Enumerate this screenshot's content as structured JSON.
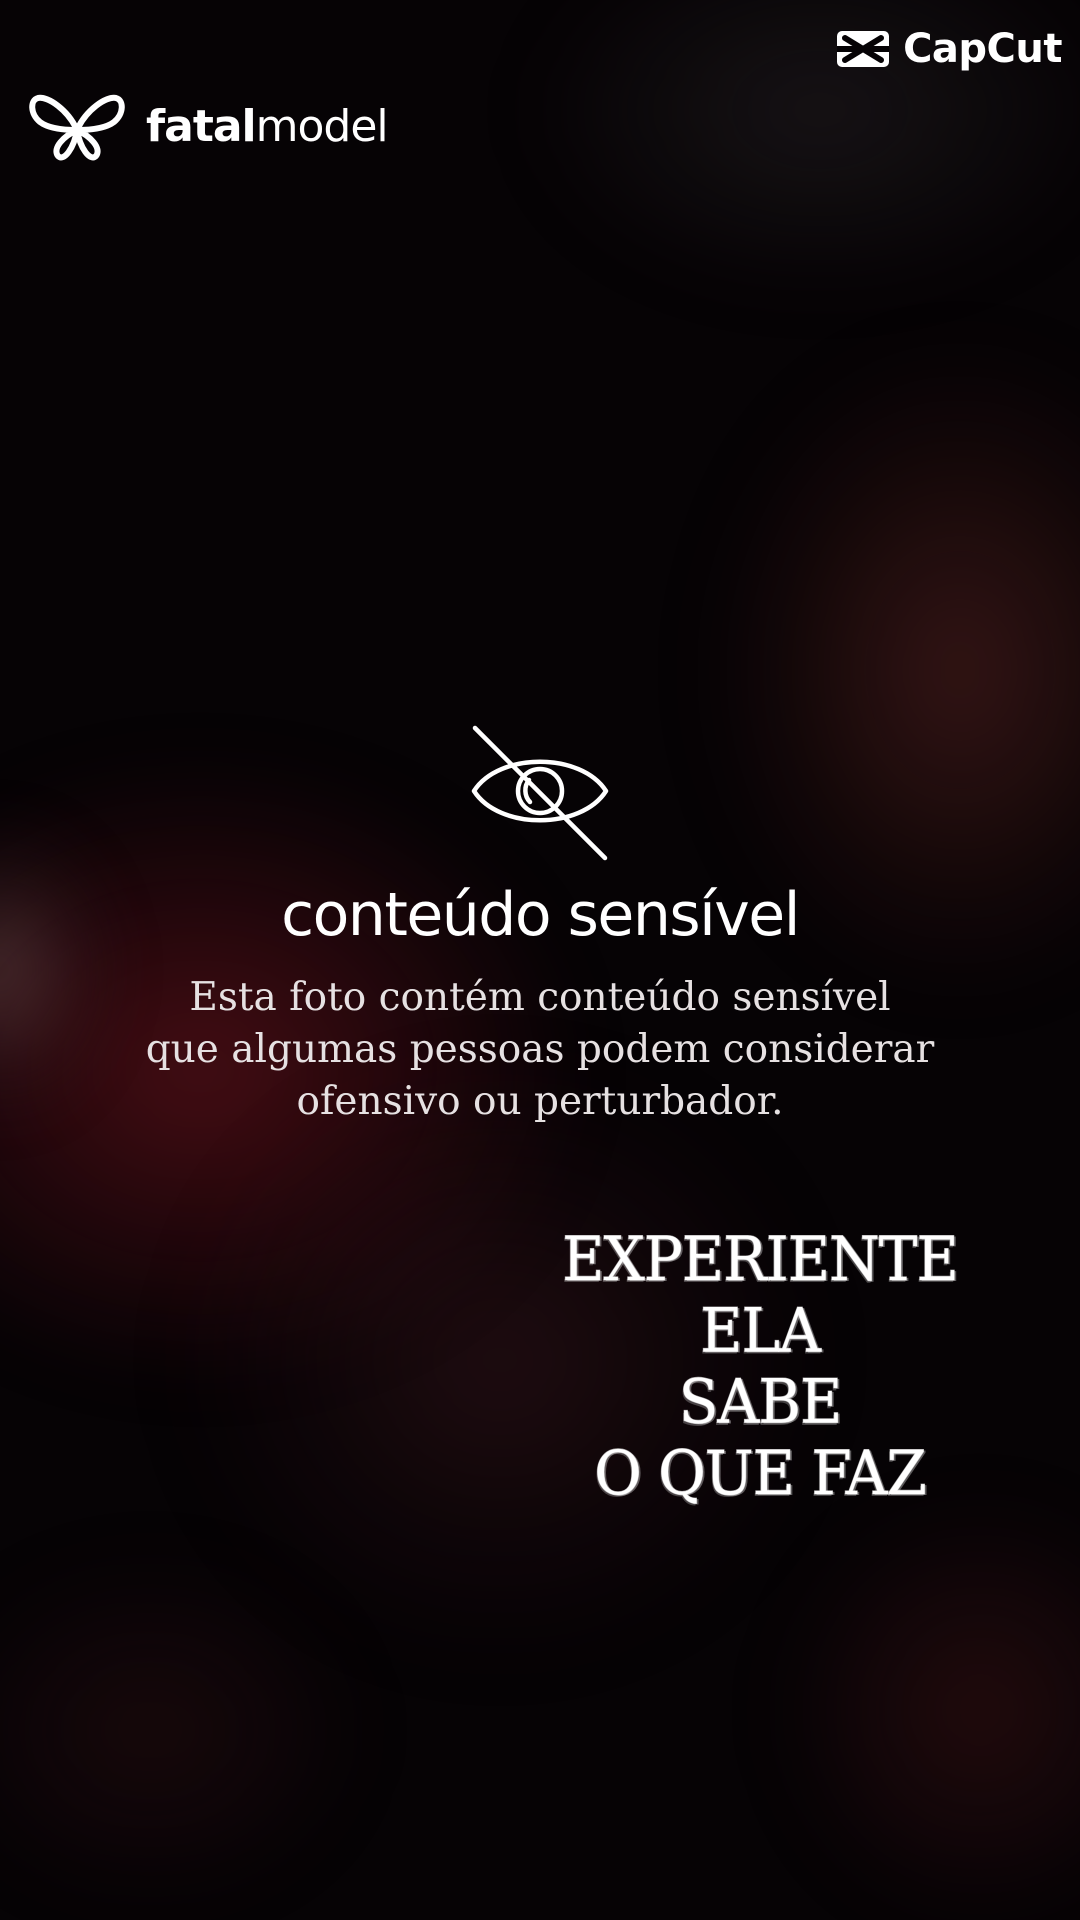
{
  "brand": {
    "logo_icon": "butterfly-logo-icon",
    "name_bold": "fatal",
    "name_light": "model"
  },
  "watermark": {
    "icon": "capcut-logo-icon",
    "label": "CapCut"
  },
  "notice": {
    "icon": "eye-slash-icon",
    "title": "conteúdo sensível",
    "body_lines": [
      "Esta foto contém conteúdo sensível",
      "que algumas pessoas podem considerar",
      "ofensivo ou perturbador."
    ]
  },
  "caption": {
    "lines": [
      "EXPERIENTE",
      "ELA",
      "SABE",
      "O QUE FAZ"
    ]
  },
  "colors": {
    "background": "#060305",
    "text_primary": "#ffffff",
    "text_secondary": "#e6e1e2",
    "glow_red": "#781620"
  }
}
